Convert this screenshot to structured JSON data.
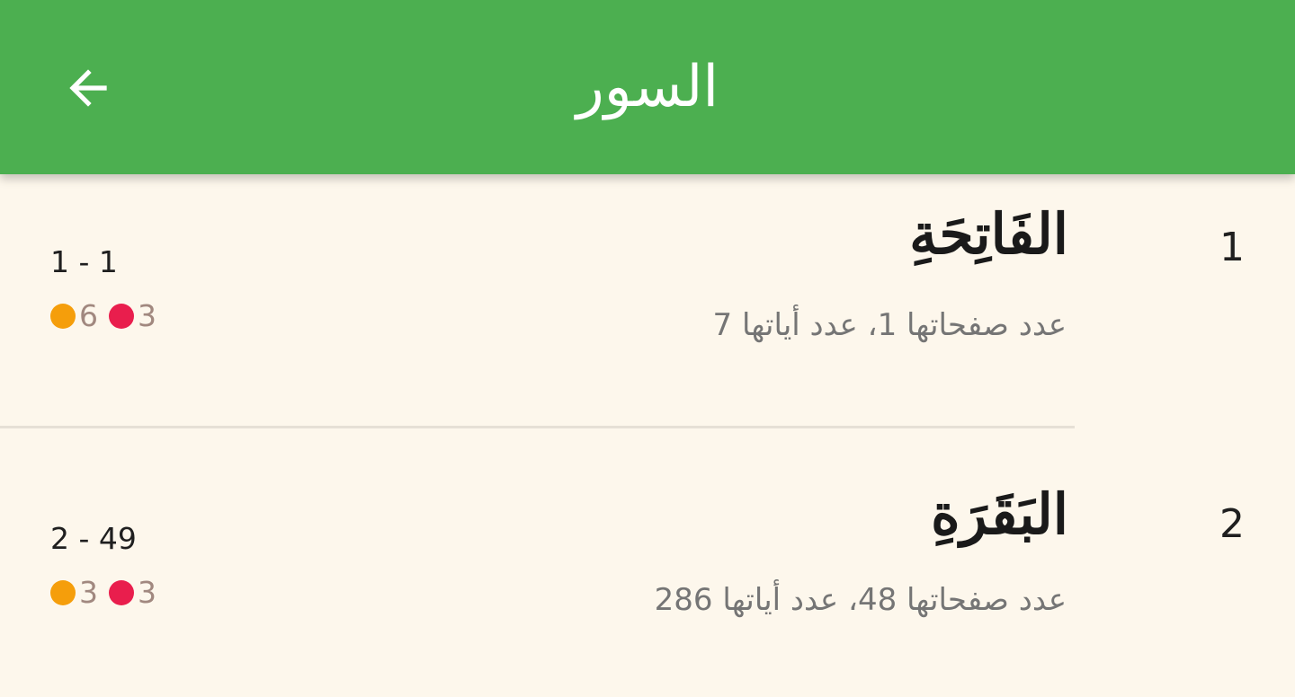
{
  "colors": {
    "app_bar": "#4caf50",
    "background": "#fdf7ec",
    "orange_dot": "#f59e0b",
    "red_dot": "#e91e4d",
    "stat_text": "#a1887f"
  },
  "header": {
    "title": "السور",
    "back_icon": "arrow-back-icon"
  },
  "suras": [
    {
      "number": "1",
      "name": "الفَاتِحَةِ",
      "info": "عدد صفحاتها 1، عدد أياتها 7",
      "pages": "1 - 1",
      "orange_count": "6",
      "red_count": "3"
    },
    {
      "number": "2",
      "name": "البَقَرَةِ",
      "info": "عدد صفحاتها 48، عدد أياتها 286",
      "pages": "2 - 49",
      "orange_count": "3",
      "red_count": "3"
    }
  ]
}
